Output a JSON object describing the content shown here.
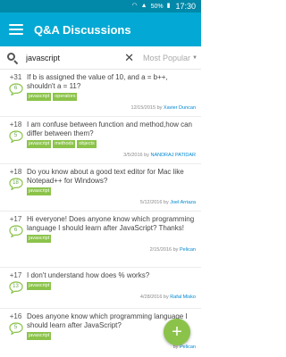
{
  "statusbar": {
    "battery": "50%",
    "time": "17:30"
  },
  "appbar": {
    "title": "Q&A Discussions"
  },
  "search": {
    "value": "javascript",
    "sort_label": "Most Popular"
  },
  "questions": [
    {
      "score": "+31",
      "answers": "6",
      "title": "If b is assigned the value of 10, and a = b++, shouldn't a = 11?",
      "tags": [
        "javascript",
        "operators"
      ],
      "date": "12/15/2015",
      "author": "Xavier Duncan"
    },
    {
      "score": "+18",
      "answers": "5",
      "title": "I am confuse between function and method,how can differ between them?",
      "tags": [
        "javascript",
        "methods",
        "objects"
      ],
      "date": "3/5/2016",
      "author": "NANDRAJ PATIDAR"
    },
    {
      "score": "+18",
      "answers": "18",
      "title": "Do you know about a good text editor for Mac like Notepad++ for Windows?",
      "tags": [
        "javascript"
      ],
      "date": "5/12/2016",
      "author": "Joel Arriaza"
    },
    {
      "score": "+17",
      "answers": "6",
      "title": "Hi everyone! Does anyone know which programming language I should learn after JavaScript? Thanks!",
      "tags": [
        "javascript"
      ],
      "date": "2/15/2016",
      "author": "Pelican"
    },
    {
      "score": "+17",
      "answers": "13",
      "title": "I don't understand how does % works?",
      "tags": [
        "javascript"
      ],
      "date": "4/28/2016",
      "author": "Rafal Misko"
    },
    {
      "score": "+16",
      "answers": "5",
      "title": "Does anyone know which programming language I should learn after JavaScript?",
      "tags": [
        "javascript"
      ],
      "date": "",
      "author": "Pelican"
    }
  ],
  "meta_by": "by"
}
